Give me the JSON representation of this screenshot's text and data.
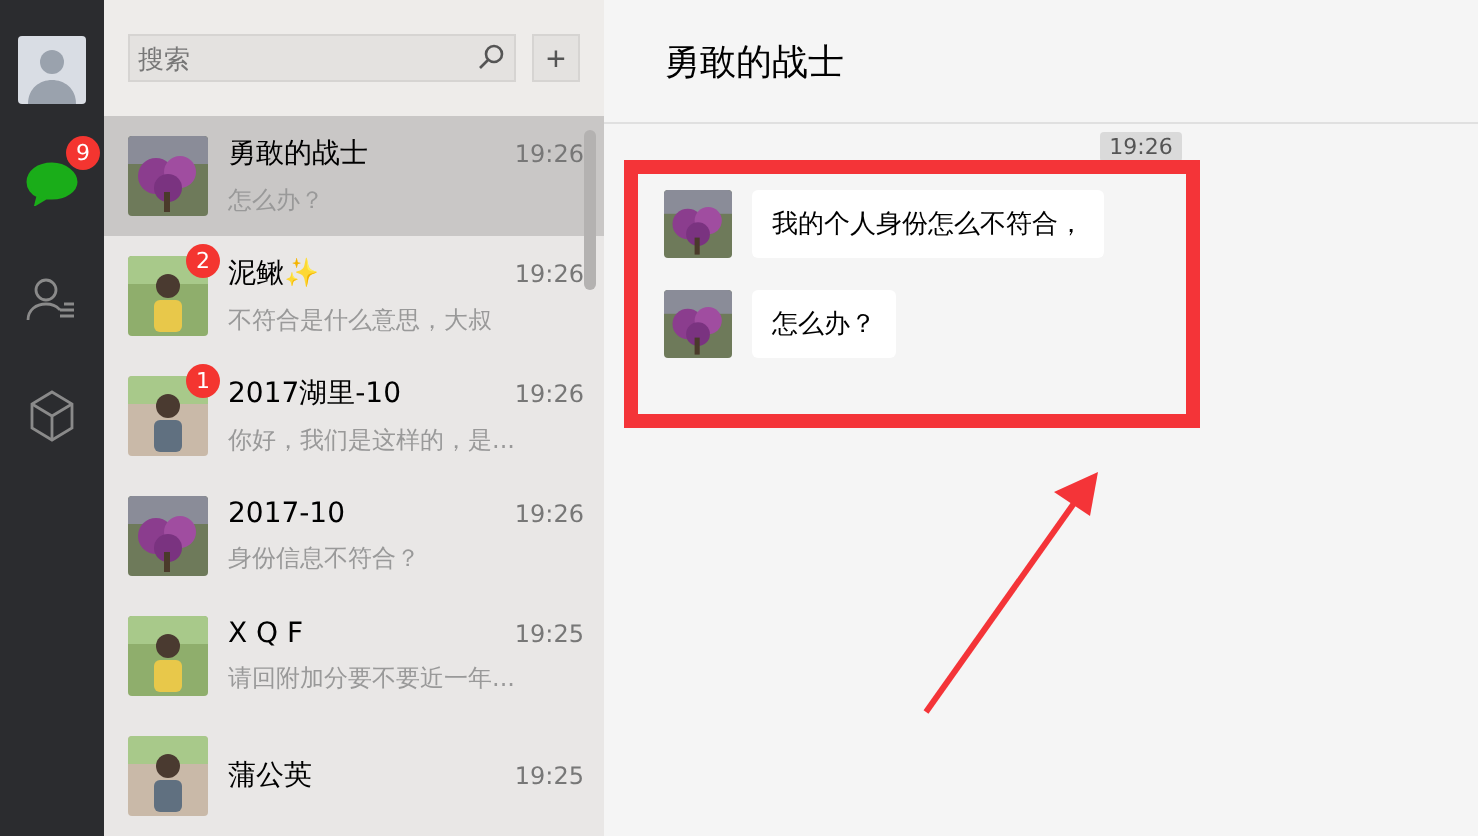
{
  "nav": [
    {
      "kind": "chats",
      "selected": true,
      "badge": "9"
    },
    {
      "kind": "contacts",
      "selected": false
    },
    {
      "kind": "favorites",
      "selected": false
    }
  ],
  "search": {
    "placeholder": "搜索",
    "add": "+"
  },
  "conversations": [
    {
      "name": "勇敢的战士",
      "time": "19:26",
      "preview": "怎么办？",
      "selected": true
    },
    {
      "name": "泥鳅✨",
      "time": "19:26",
      "preview": "不符合是什么意思，大叔",
      "selected": false,
      "badge": "2"
    },
    {
      "name": "2017湖里-10",
      "time": "19:26",
      "preview": "你好，我们是这样的，是...",
      "selected": false,
      "badge": "1"
    },
    {
      "name": "2017-10",
      "time": "19:26",
      "preview": "身份信息不符合？",
      "selected": false
    },
    {
      "name": "X Q F",
      "time": "19:25",
      "preview": "请回附加分要不要近一年...",
      "selected": false
    },
    {
      "name": "蒲公英",
      "time": "19:25",
      "selected": false
    }
  ],
  "chat": {
    "title": "勇敢的战士",
    "timestamp": "19:26",
    "messages": [
      {
        "text": "我的个人身份怎么不符合，"
      },
      {
        "text": "怎么办？"
      }
    ]
  }
}
